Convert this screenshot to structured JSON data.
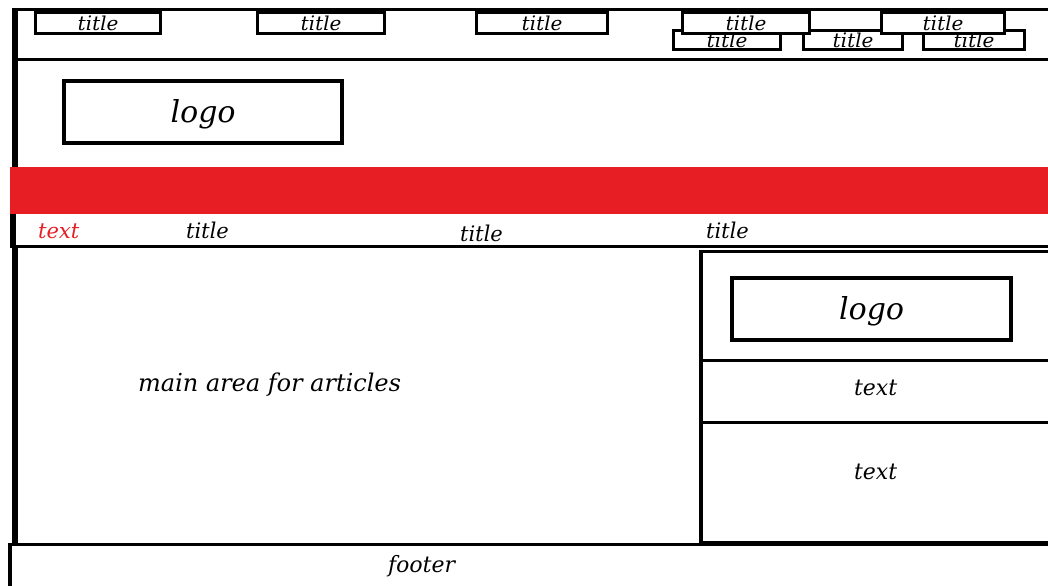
{
  "top_links": [
    "title",
    "title",
    "title"
  ],
  "header": {
    "logo": "logo"
  },
  "nav": {
    "items": [
      "title",
      "title",
      "title",
      "title",
      "title"
    ]
  },
  "subnav": {
    "items": [
      "text",
      "title",
      "title",
      "title"
    ],
    "accent_color": "#e81e25"
  },
  "main": {
    "label": "main area for articles"
  },
  "sidebar": {
    "logo": "logo",
    "text1": "text",
    "text2": "text"
  },
  "footer": {
    "label": "footer"
  },
  "colors": {
    "nav_bg": "#e81e25",
    "border": "#000000"
  }
}
